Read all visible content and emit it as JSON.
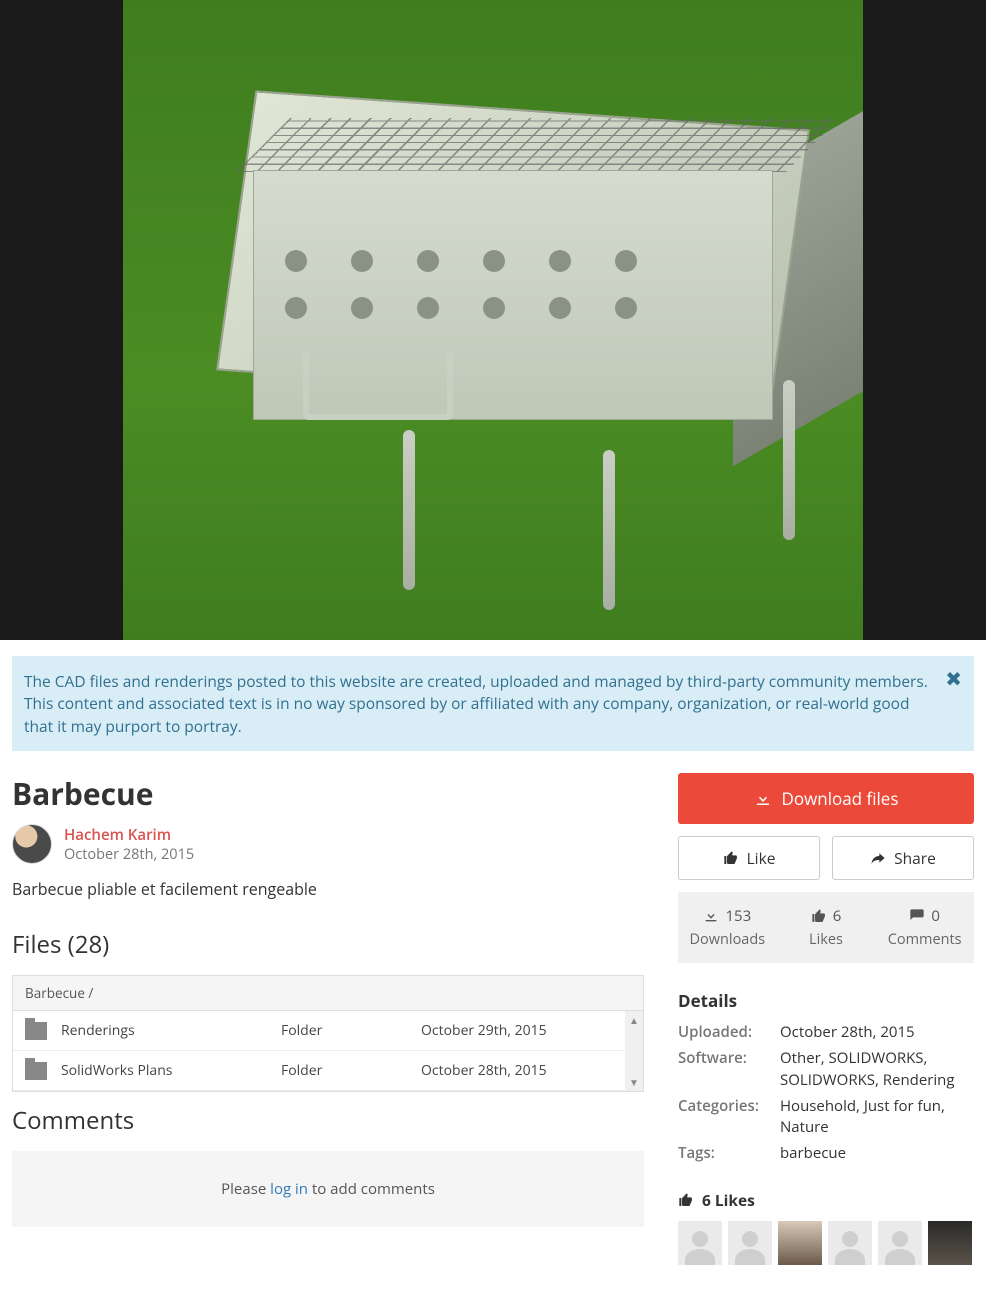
{
  "disclaimer": {
    "text": "The CAD files and renderings posted to this website are created, uploaded and managed by third-party community members. This content and associated text is in no way sponsored by or affiliated with any company, organization, or real-world good that it may purport to portray."
  },
  "title": "Barbecue",
  "author": {
    "name": "Hachem Karim",
    "date": "October 28th, 2015"
  },
  "description": "Barbecue pliable et facilement rengeable",
  "files": {
    "heading": "Files (28)",
    "breadcrumb": "Barbecue /",
    "rows": [
      {
        "name": "Renderings",
        "type": "Folder",
        "date": "October 29th, 2015"
      },
      {
        "name": "SolidWorks Plans",
        "type": "Folder",
        "date": "October 28th, 2015"
      }
    ]
  },
  "comments": {
    "heading": "Comments",
    "prompt_pre": "Please ",
    "login": "log in",
    "prompt_post": " to add comments"
  },
  "actions": {
    "download": "Download files",
    "like": "Like",
    "share": "Share"
  },
  "stats": {
    "downloads": {
      "value": "153",
      "label": "Downloads"
    },
    "likes": {
      "value": "6",
      "label": "Likes"
    },
    "comments": {
      "value": "0",
      "label": "Comments"
    }
  },
  "details": {
    "heading": "Details",
    "uploaded_label": "Uploaded:",
    "uploaded": "October 28th, 2015",
    "software_label": "Software:",
    "software": "Other, SOLIDWORKS, SOLIDWORKS, Rendering",
    "categories_label": "Categories:",
    "categories": "Household, Just for fun, Nature",
    "tags_label": "Tags:",
    "tags": "barbecue"
  },
  "likes_section": {
    "heading": "6 Likes"
  }
}
